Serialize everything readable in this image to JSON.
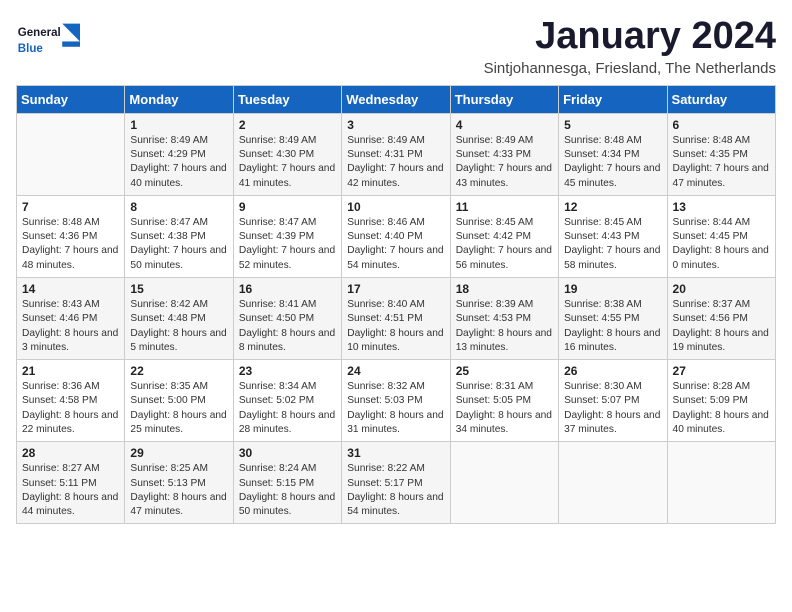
{
  "header": {
    "logo_general": "General",
    "logo_blue": "Blue",
    "title": "January 2024",
    "location": "Sintjohannesga, Friesland, The Netherlands"
  },
  "weekdays": [
    "Sunday",
    "Monday",
    "Tuesday",
    "Wednesday",
    "Thursday",
    "Friday",
    "Saturday"
  ],
  "weeks": [
    [
      {
        "day": "",
        "sunrise": "",
        "sunset": "",
        "daylight": ""
      },
      {
        "day": "1",
        "sunrise": "Sunrise: 8:49 AM",
        "sunset": "Sunset: 4:29 PM",
        "daylight": "Daylight: 7 hours and 40 minutes."
      },
      {
        "day": "2",
        "sunrise": "Sunrise: 8:49 AM",
        "sunset": "Sunset: 4:30 PM",
        "daylight": "Daylight: 7 hours and 41 minutes."
      },
      {
        "day": "3",
        "sunrise": "Sunrise: 8:49 AM",
        "sunset": "Sunset: 4:31 PM",
        "daylight": "Daylight: 7 hours and 42 minutes."
      },
      {
        "day": "4",
        "sunrise": "Sunrise: 8:49 AM",
        "sunset": "Sunset: 4:33 PM",
        "daylight": "Daylight: 7 hours and 43 minutes."
      },
      {
        "day": "5",
        "sunrise": "Sunrise: 8:48 AM",
        "sunset": "Sunset: 4:34 PM",
        "daylight": "Daylight: 7 hours and 45 minutes."
      },
      {
        "day": "6",
        "sunrise": "Sunrise: 8:48 AM",
        "sunset": "Sunset: 4:35 PM",
        "daylight": "Daylight: 7 hours and 47 minutes."
      }
    ],
    [
      {
        "day": "7",
        "sunrise": "Sunrise: 8:48 AM",
        "sunset": "Sunset: 4:36 PM",
        "daylight": "Daylight: 7 hours and 48 minutes."
      },
      {
        "day": "8",
        "sunrise": "Sunrise: 8:47 AM",
        "sunset": "Sunset: 4:38 PM",
        "daylight": "Daylight: 7 hours and 50 minutes."
      },
      {
        "day": "9",
        "sunrise": "Sunrise: 8:47 AM",
        "sunset": "Sunset: 4:39 PM",
        "daylight": "Daylight: 7 hours and 52 minutes."
      },
      {
        "day": "10",
        "sunrise": "Sunrise: 8:46 AM",
        "sunset": "Sunset: 4:40 PM",
        "daylight": "Daylight: 7 hours and 54 minutes."
      },
      {
        "day": "11",
        "sunrise": "Sunrise: 8:45 AM",
        "sunset": "Sunset: 4:42 PM",
        "daylight": "Daylight: 7 hours and 56 minutes."
      },
      {
        "day": "12",
        "sunrise": "Sunrise: 8:45 AM",
        "sunset": "Sunset: 4:43 PM",
        "daylight": "Daylight: 7 hours and 58 minutes."
      },
      {
        "day": "13",
        "sunrise": "Sunrise: 8:44 AM",
        "sunset": "Sunset: 4:45 PM",
        "daylight": "Daylight: 8 hours and 0 minutes."
      }
    ],
    [
      {
        "day": "14",
        "sunrise": "Sunrise: 8:43 AM",
        "sunset": "Sunset: 4:46 PM",
        "daylight": "Daylight: 8 hours and 3 minutes."
      },
      {
        "day": "15",
        "sunrise": "Sunrise: 8:42 AM",
        "sunset": "Sunset: 4:48 PM",
        "daylight": "Daylight: 8 hours and 5 minutes."
      },
      {
        "day": "16",
        "sunrise": "Sunrise: 8:41 AM",
        "sunset": "Sunset: 4:50 PM",
        "daylight": "Daylight: 8 hours and 8 minutes."
      },
      {
        "day": "17",
        "sunrise": "Sunrise: 8:40 AM",
        "sunset": "Sunset: 4:51 PM",
        "daylight": "Daylight: 8 hours and 10 minutes."
      },
      {
        "day": "18",
        "sunrise": "Sunrise: 8:39 AM",
        "sunset": "Sunset: 4:53 PM",
        "daylight": "Daylight: 8 hours and 13 minutes."
      },
      {
        "day": "19",
        "sunrise": "Sunrise: 8:38 AM",
        "sunset": "Sunset: 4:55 PM",
        "daylight": "Daylight: 8 hours and 16 minutes."
      },
      {
        "day": "20",
        "sunrise": "Sunrise: 8:37 AM",
        "sunset": "Sunset: 4:56 PM",
        "daylight": "Daylight: 8 hours and 19 minutes."
      }
    ],
    [
      {
        "day": "21",
        "sunrise": "Sunrise: 8:36 AM",
        "sunset": "Sunset: 4:58 PM",
        "daylight": "Daylight: 8 hours and 22 minutes."
      },
      {
        "day": "22",
        "sunrise": "Sunrise: 8:35 AM",
        "sunset": "Sunset: 5:00 PM",
        "daylight": "Daylight: 8 hours and 25 minutes."
      },
      {
        "day": "23",
        "sunrise": "Sunrise: 8:34 AM",
        "sunset": "Sunset: 5:02 PM",
        "daylight": "Daylight: 8 hours and 28 minutes."
      },
      {
        "day": "24",
        "sunrise": "Sunrise: 8:32 AM",
        "sunset": "Sunset: 5:03 PM",
        "daylight": "Daylight: 8 hours and 31 minutes."
      },
      {
        "day": "25",
        "sunrise": "Sunrise: 8:31 AM",
        "sunset": "Sunset: 5:05 PM",
        "daylight": "Daylight: 8 hours and 34 minutes."
      },
      {
        "day": "26",
        "sunrise": "Sunrise: 8:30 AM",
        "sunset": "Sunset: 5:07 PM",
        "daylight": "Daylight: 8 hours and 37 minutes."
      },
      {
        "day": "27",
        "sunrise": "Sunrise: 8:28 AM",
        "sunset": "Sunset: 5:09 PM",
        "daylight": "Daylight: 8 hours and 40 minutes."
      }
    ],
    [
      {
        "day": "28",
        "sunrise": "Sunrise: 8:27 AM",
        "sunset": "Sunset: 5:11 PM",
        "daylight": "Daylight: 8 hours and 44 minutes."
      },
      {
        "day": "29",
        "sunrise": "Sunrise: 8:25 AM",
        "sunset": "Sunset: 5:13 PM",
        "daylight": "Daylight: 8 hours and 47 minutes."
      },
      {
        "day": "30",
        "sunrise": "Sunrise: 8:24 AM",
        "sunset": "Sunset: 5:15 PM",
        "daylight": "Daylight: 8 hours and 50 minutes."
      },
      {
        "day": "31",
        "sunrise": "Sunrise: 8:22 AM",
        "sunset": "Sunset: 5:17 PM",
        "daylight": "Daylight: 8 hours and 54 minutes."
      },
      {
        "day": "",
        "sunrise": "",
        "sunset": "",
        "daylight": ""
      },
      {
        "day": "",
        "sunrise": "",
        "sunset": "",
        "daylight": ""
      },
      {
        "day": "",
        "sunrise": "",
        "sunset": "",
        "daylight": ""
      }
    ]
  ]
}
